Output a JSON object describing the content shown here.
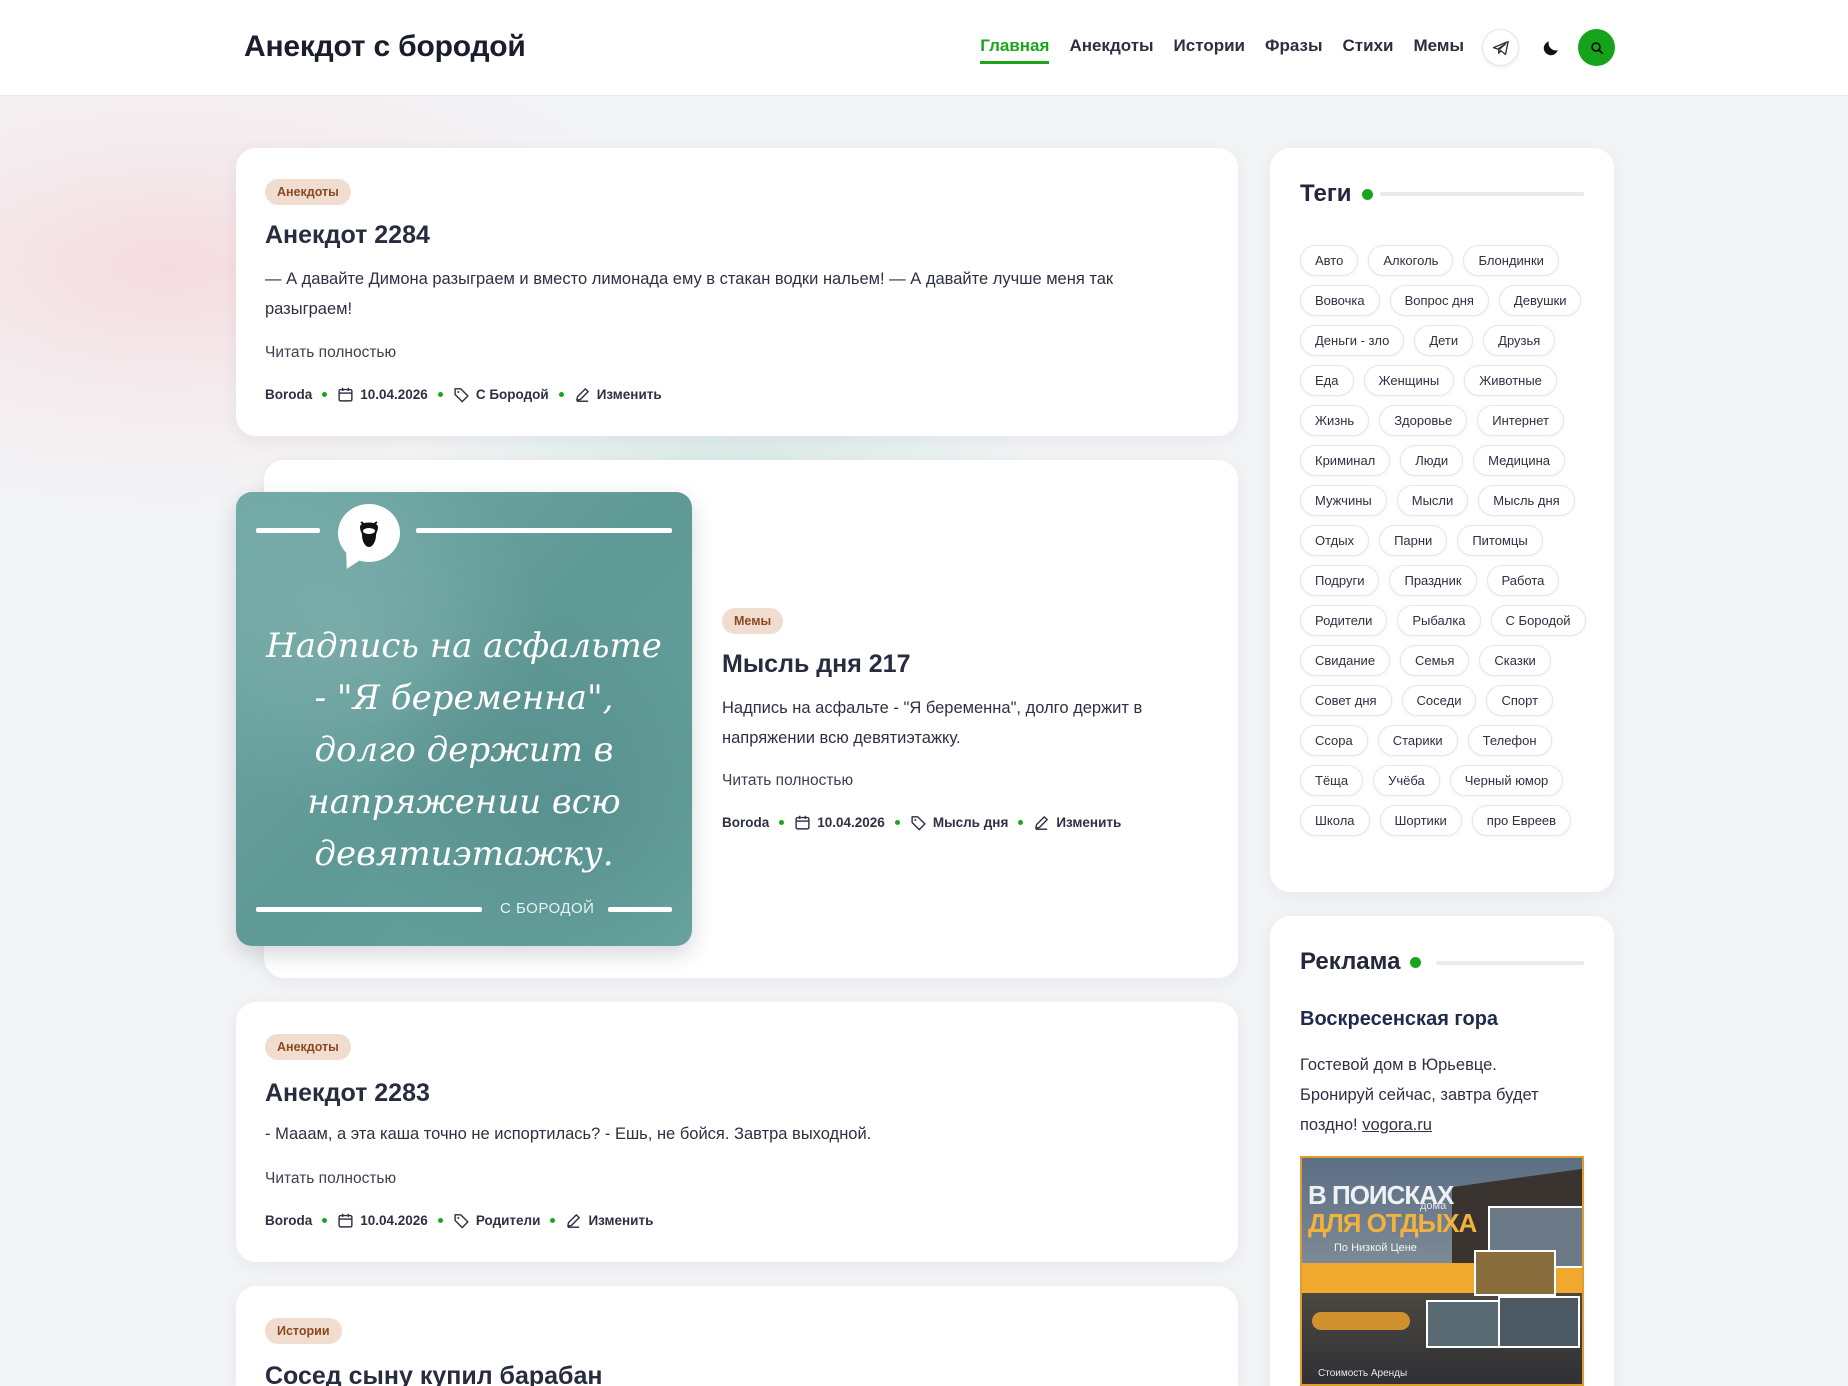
{
  "header": {
    "site_title": "Анекдот с бородой",
    "nav": [
      "Главная",
      "Анекдоты",
      "Истории",
      "Фразы",
      "Стихи",
      "Мемы"
    ],
    "active_nav": "Главная",
    "accent_color": "#1aa51d"
  },
  "posts": [
    {
      "category": "Анекдоты",
      "title": "Анекдот 2284",
      "text": "— А давайте Димона разыграем и вместо лимонада ему в стакан водки нальем! — А давайте лучше меня так разыграем!",
      "read_more": "Читать полностью",
      "author": "Boroda",
      "date": "10.04.2026",
      "tag": "С Бородой",
      "edit": "Изменить"
    },
    {
      "category": "Мемы",
      "title": "Мысль дня 217",
      "text": "Надпись на асфальте - \"Я беременна\", долго держит в напряжении всю девятиэтажку.",
      "read_more": "Читать полностью",
      "author": "Boroda",
      "date": "10.04.2026",
      "tag": "Мысль дня",
      "edit": "Изменить",
      "image_text": "Надпись на асфальте - \"Я беременна\", долго держит в напряжении всю девятиэтажку.",
      "image_brand": "С БОРОДОЙ"
    },
    {
      "category": "Анекдоты",
      "title": "Анекдот 2283",
      "text": "- Мааам, а эта каша точно не испортилась? - Ешь, не бойся. Завтра выходной.",
      "read_more": "Читать полностью",
      "author": "Boroda",
      "date": "10.04.2026",
      "tag": "Родители",
      "edit": "Изменить"
    },
    {
      "category": "Истории",
      "title": "Сосед сыну купил барабан"
    }
  ],
  "sidebar": {
    "tags_title": "Теги",
    "tags": [
      "Авто",
      "Алкоголь",
      "Блондинки",
      "Вовочка",
      "Вопрос дня",
      "Девушки",
      "Деньги - зло",
      "Дети",
      "Друзья",
      "Еда",
      "Женщины",
      "Животные",
      "Жизнь",
      "Здоровье",
      "Интернет",
      "Криминал",
      "Люди",
      "Медицина",
      "Мужчины",
      "Мысли",
      "Мысль дня",
      "Отдых",
      "Парни",
      "Питомцы",
      "Подруги",
      "Праздник",
      "Работа",
      "Родители",
      "Рыбалка",
      "С Бородой",
      "Свидание",
      "Семья",
      "Сказки",
      "Совет дня",
      "Соседи",
      "Спорт",
      "Ссора",
      "Старики",
      "Телефон",
      "Тёща",
      "Учёба",
      "Черный юмор",
      "Школа",
      "Шортики",
      "про Евреев"
    ],
    "ad_title": "Реклама",
    "ad_heading": "Воскресенская гора",
    "ad_text": "Гостевой дом в Юрьевце. Бронируй сейчас, завтра будет поздно!",
    "ad_link": "vogora.ru",
    "ad_image": {
      "line1": "В ПОИСКАХ",
      "line2": "ДЛЯ ОТДЫХА",
      "small": "дома",
      "sub": "По Низкой Цене",
      "footer": "Стоимость Аренды"
    }
  }
}
